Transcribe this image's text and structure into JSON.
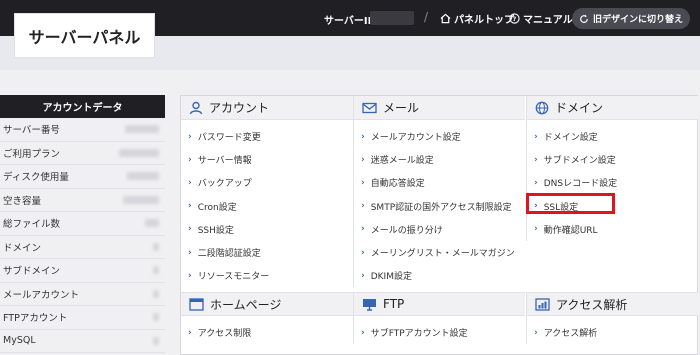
{
  "header": {
    "logo": "サーバーパネル",
    "server_id_label": "サーバーID",
    "nav_panel_top": "パネルトップ",
    "nav_manual": "マニュアル",
    "old_design_button": "旧デザインに切り替え"
  },
  "sidebar": {
    "title": "アカウントデータ",
    "rows": [
      {
        "label": "サーバー番号"
      },
      {
        "label": "ご利用プラン"
      },
      {
        "label": "ディスク使用量"
      },
      {
        "label": "空き容量"
      },
      {
        "label": "総ファイル数"
      },
      {
        "label": "ドメイン"
      },
      {
        "label": "サブドメイン"
      },
      {
        "label": "メールアカウント"
      },
      {
        "label": "FTPアカウント"
      },
      {
        "label": "MySQL"
      }
    ]
  },
  "sections": {
    "account": {
      "title": "アカウント",
      "icon": "user-icon",
      "links": [
        "パスワード変更",
        "サーバー情報",
        "バックアップ",
        "Cron設定",
        "SSH設定",
        "二段階認証設定",
        "リソースモニター"
      ]
    },
    "mail": {
      "title": "メール",
      "icon": "envelope-icon",
      "links": [
        "メールアカウント設定",
        "迷惑メール設定",
        "自動応答設定",
        "SMTP認証の国外アクセス制限設定",
        "メールの振り分け",
        "メーリングリスト・メールマガジン",
        "DKIM設定"
      ]
    },
    "domain": {
      "title": "ドメイン",
      "icon": "globe-icon",
      "links": [
        "ドメイン設定",
        "サブドメイン設定",
        "DNSレコード設定",
        "SSL設定",
        "動作確認URL"
      ]
    },
    "homepage": {
      "title": "ホームページ",
      "icon": "window-icon",
      "links": [
        "アクセス制限"
      ]
    },
    "ftp": {
      "title": "FTP",
      "icon": "monitor-icon",
      "links": [
        "サブFTPアカウント設定"
      ]
    },
    "analytics": {
      "title": "アクセス解析",
      "icon": "chart-icon",
      "links": [
        "アクセス解析"
      ]
    }
  },
  "colors": {
    "accent_blue": "#3565b5",
    "highlight_red": "#e0141e",
    "topbar": "#1f1f24"
  }
}
